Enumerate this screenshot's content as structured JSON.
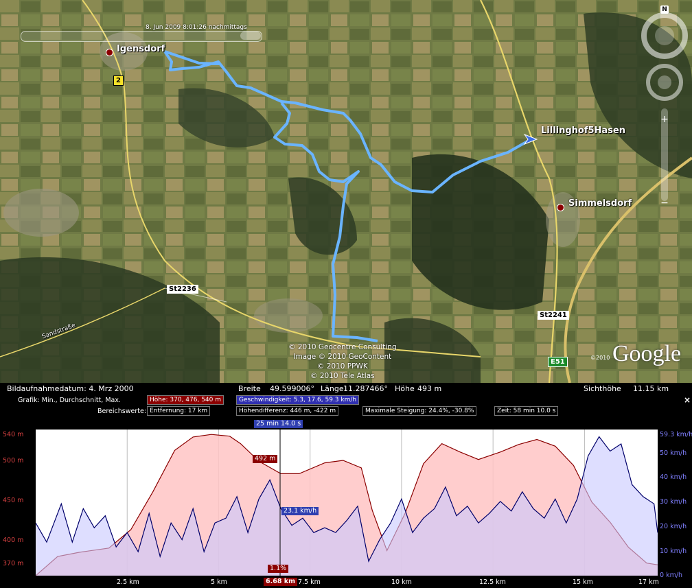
{
  "map": {
    "timeslider_label": "8. Jun 2009   8:01:26 nachmittags",
    "places": [
      {
        "name": "Igensdorf",
        "icon": "place-pin-icon"
      },
      {
        "name": "Lillinghof5Hasen",
        "icon": "placemark-arrow-icon"
      },
      {
        "name": "Simmelsdorf",
        "icon": "place-pin-icon"
      }
    ],
    "roads": {
      "b2": "2",
      "s12236": "St2236",
      "s12241": "St2241",
      "e51": "E51",
      "street": "Sandstraße"
    },
    "copyright": [
      "© 2010 Geocentre Consulting",
      "Image © 2010 GeoContent",
      "© 2010 PPWK",
      "© 2010 Tele Atlas"
    ],
    "logo_year": "©2010",
    "logo": "Google",
    "compass_letter": "N",
    "track_color": "#6ab4ff"
  },
  "status": {
    "image_date": "Bildaufnahmedatum:  4. Mrz 2000",
    "lat_label": "Breite",
    "lat": "49.599006°",
    "lon_label": "Länge",
    "lon": "11.287466°",
    "alt_label": "Höhe",
    "alt": "493 m",
    "eye_label": "Sichthöhe",
    "eye": "11.15 km"
  },
  "elevation": {
    "graph_label": "Grafik: Min., Durchschnitt, Max.",
    "height_stats": "Höhe: 370, 476, 540 m",
    "speed_stats": "Geschwindigkeit: 5.3, 17.6, 59.3 km/h",
    "range_label": "Bereichswerte:",
    "distance": "Entfernung: 17 km",
    "height_diff": "Höhendifferenz: 446 m, -422 m",
    "max_slope": "Maximale Steigung: 24.4%, -30.8%",
    "time": "Zeit: 58 min 10.0 s",
    "cursor_time": "25 min 14.0 s",
    "cursor_height": "492 m",
    "cursor_speed": "23.1 km/h",
    "cursor_slope": "1.1%",
    "cursor_distance": "6.68 km",
    "close": "×"
  },
  "chart_data": {
    "type": "area",
    "xlabel": "",
    "x_ticks": [
      "2.5 km",
      "5 km",
      "7.5 km",
      "10 km",
      "12.5 km",
      "15 km",
      "17 km"
    ],
    "y_left_ticks": [
      "540 m",
      "500 m",
      "450 m",
      "400 m",
      "370 m"
    ],
    "y_right_ticks": [
      "59.3 km/h",
      "50 km/h",
      "40 km/h",
      "30 km/h",
      "20 km/h",
      "10 km/h",
      "0 km/h"
    ],
    "xlim": [
      0,
      17
    ],
    "ylim_left": [
      370,
      540
    ],
    "ylim_right": [
      0,
      59.3
    ],
    "series": [
      {
        "name": "Höhe",
        "color": "#8b0000",
        "fill": "#ffc4c4",
        "x": [
          0,
          0.6,
          1.2,
          2,
          2.6,
          3.2,
          3.8,
          4.3,
          4.8,
          5.3,
          5.6,
          6.1,
          6.7,
          7.2,
          7.9,
          8.4,
          8.9,
          9.2,
          9.6,
          10.1,
          10.6,
          11.1,
          11.6,
          12.1,
          12.7,
          13.2,
          13.7,
          14.2,
          14.7,
          15.2,
          15.7,
          16.2,
          16.7,
          17
        ],
        "y": [
          370,
          393,
          398,
          403,
          425,
          470,
          520,
          536,
          539,
          537,
          528,
          507,
          492,
          492,
          505,
          508,
          499,
          448,
          400,
          445,
          504,
          528,
          518,
          509,
          518,
          527,
          533,
          525,
          502,
          458,
          434,
          404,
          385,
          383
        ]
      },
      {
        "name": "Geschwindigkeit",
        "color": "#00006b",
        "fill": "#c8c8ff",
        "x": [
          0,
          0.3,
          0.7,
          1,
          1.3,
          1.6,
          1.9,
          2.2,
          2.5,
          2.8,
          3.1,
          3.4,
          3.7,
          4,
          4.3,
          4.6,
          4.9,
          5.2,
          5.5,
          5.8,
          6.1,
          6.4,
          6.7,
          7,
          7.3,
          7.6,
          7.9,
          8.2,
          8.5,
          8.8,
          9.1,
          9.4,
          9.7,
          10,
          10.3,
          10.6,
          10.9,
          11.2,
          11.5,
          11.8,
          12.1,
          12.4,
          12.7,
          13,
          13.3,
          13.6,
          13.9,
          14.2,
          14.5,
          14.8,
          15.1,
          15.4,
          15.7,
          16,
          16.3,
          16.6,
          16.9,
          17
        ],
        "y": [
          22,
          14,
          30,
          14,
          28,
          20,
          25,
          12,
          18,
          10,
          26,
          8,
          22,
          15,
          28,
          10,
          22,
          24,
          33,
          18,
          32,
          40,
          28,
          21,
          24,
          18,
          20,
          18,
          23,
          29,
          6,
          15,
          22,
          32,
          18,
          24,
          28,
          37,
          25,
          29,
          22,
          26,
          31,
          27,
          35,
          28,
          24,
          32,
          22,
          32,
          50,
          58,
          52,
          55,
          38,
          33,
          30,
          18
        ]
      }
    ]
  }
}
